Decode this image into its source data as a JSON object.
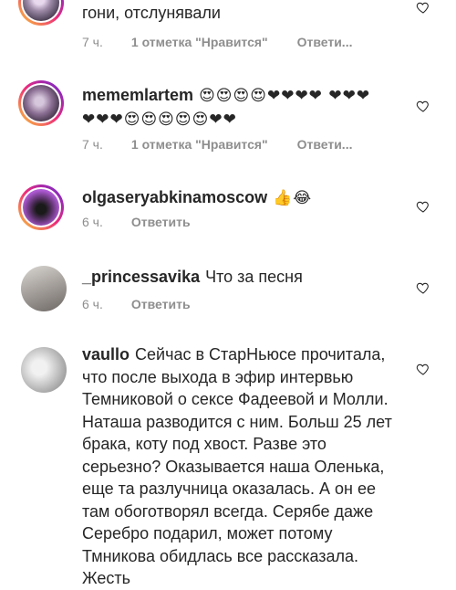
{
  "comments": [
    {
      "username": "",
      "text": "гони, отслунявали",
      "time": "7 ч.",
      "likes": "1 отметка \"Нравится\"",
      "reply": "Ответи..."
    },
    {
      "username": "mememlartem",
      "text": "😍😍😍😍❤❤❤❤ ❤❤❤❤❤❤😍😍😍😍😍❤❤",
      "time": "7 ч.",
      "likes": "1 отметка \"Нравится\"",
      "reply": "Ответи..."
    },
    {
      "username": "olgaseryabkinamoscow",
      "text": "👍😂",
      "time": "6 ч.",
      "reply": "Ответить"
    },
    {
      "username": "_princessavika",
      "text": "Что за песня",
      "time": "6 ч.",
      "reply": "Ответить"
    },
    {
      "username": "vaullo",
      "text": "Сейчас в СтарНьюсе прочитала, что после выхода в эфир интервью Темниковой о сексе Фадеевой и Молли. Наташа разводится с ним. Больш 25 лет брака, коту под хвост. Разве это серьезно? Оказывается наша Оленька, еще та разлучница оказалась. А он ее там обоготворял всегда. Серябе даже Серебро подарил, может потому Тмникова обидлась все рассказала. Жесть"
    }
  ],
  "icons": {
    "like": "heart-outline-icon"
  }
}
